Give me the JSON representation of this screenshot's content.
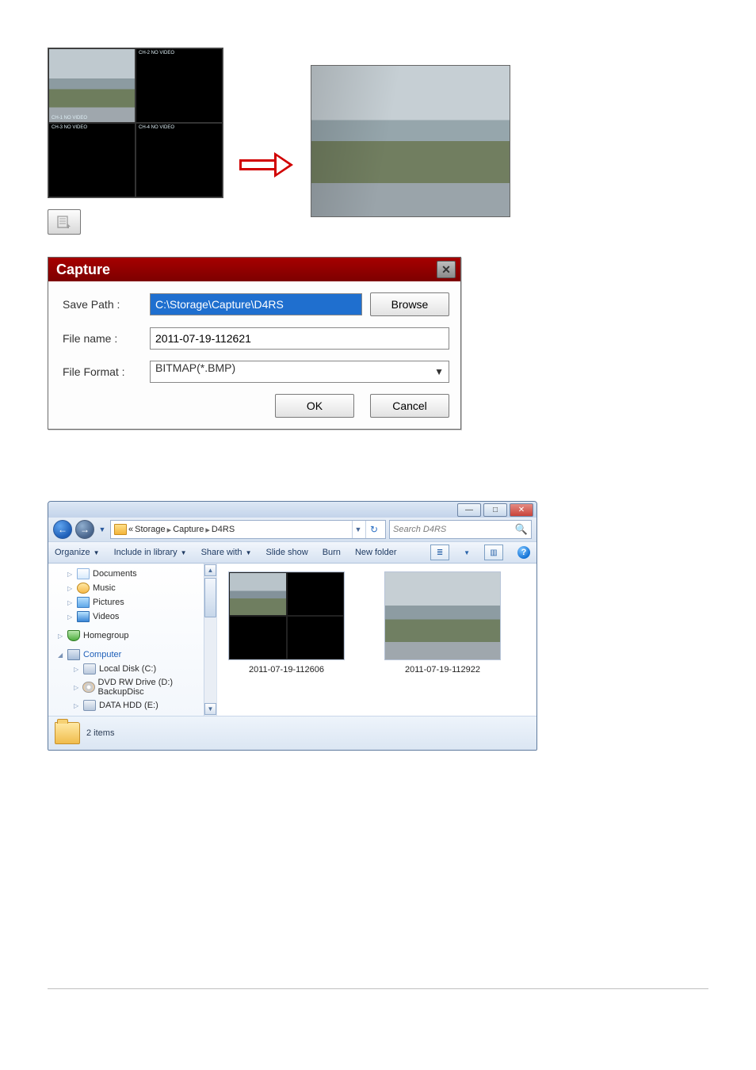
{
  "preview": {
    "quad": {
      "ch1": {
        "top": "",
        "bot": "CH-1\nNO VIDEO"
      },
      "ch2": {
        "top": "CH-2\nNO VIDEO",
        "bot": ""
      },
      "ch3": {
        "top": "",
        "bot": "CH-3\nNO VIDEO"
      },
      "ch4": {
        "top": "CH-4\nNO VIDEO",
        "bot": ""
      }
    }
  },
  "capture": {
    "title": "Capture",
    "labels": {
      "savePath": "Save Path :",
      "fileName": "File name :",
      "fileFormat": "File Format :"
    },
    "values": {
      "savePath": "C:\\Storage\\Capture\\D4RS",
      "fileName": "2011-07-19-112621",
      "fileFormat": "BITMAP(*.BMP)"
    },
    "buttons": {
      "browse": "Browse",
      "ok": "OK",
      "cancel": "Cancel"
    }
  },
  "explorer": {
    "breadcrumbs": {
      "pre": "«",
      "a": "Storage",
      "b": "Capture",
      "c": "D4RS"
    },
    "search": {
      "placeholder": "Search D4RS"
    },
    "toolbar": {
      "organize": "Organize",
      "include": "Include in library",
      "share": "Share with",
      "slideshow": "Slide show",
      "burn": "Burn",
      "newFolder": "New folder"
    },
    "tree": {
      "documents": "Documents",
      "music": "Music",
      "pictures": "Pictures",
      "videos": "Videos",
      "homegroup": "Homegroup",
      "computer": "Computer",
      "localDisk": "Local Disk (C:)",
      "dvd": "DVD RW Drive (D:) BackupDisc",
      "dataHdd": "DATA HDD (E:)"
    },
    "items": [
      {
        "name": "2011-07-19-112606"
      },
      {
        "name": "2011-07-19-112922"
      }
    ],
    "status": "2 items"
  }
}
